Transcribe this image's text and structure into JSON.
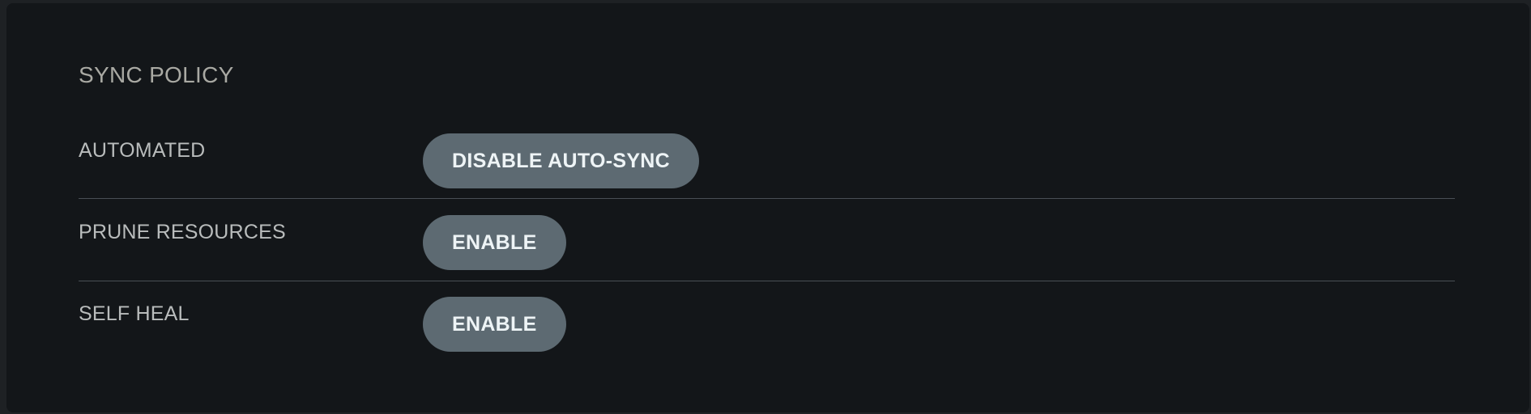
{
  "section": {
    "title": "SYNC POLICY"
  },
  "rows": [
    {
      "label": "AUTOMATED",
      "button_label": "DISABLE AUTO-SYNC"
    },
    {
      "label": "PRUNE RESOURCES",
      "button_label": "ENABLE"
    },
    {
      "label": "SELF HEAL",
      "button_label": "ENABLE"
    }
  ],
  "colors": {
    "background": "#131619",
    "button": "#5d6a72",
    "button_text": "#eef4f6",
    "label_text": "#b9bcbc",
    "title_text": "#a9a9a3",
    "divider": "#494f55"
  }
}
